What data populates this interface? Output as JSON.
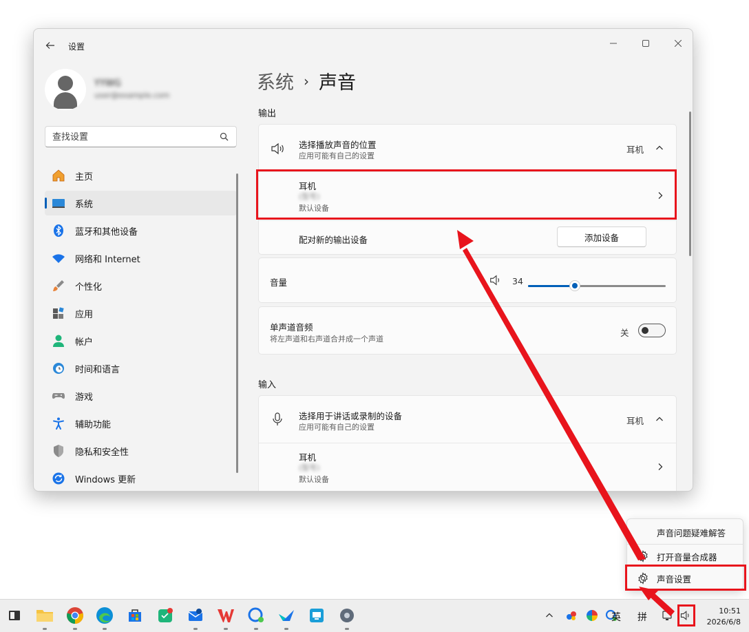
{
  "window": {
    "title": "设置",
    "back_icon": "arrow-left-icon"
  },
  "user": {
    "name": "YYWG",
    "email": "user@example.com"
  },
  "search": {
    "placeholder": "查找设置"
  },
  "sidebar": {
    "items": [
      {
        "label": "主页",
        "icon": "home-icon"
      },
      {
        "label": "系统",
        "icon": "system-icon",
        "active": true
      },
      {
        "label": "蓝牙和其他设备",
        "icon": "bluetooth-icon"
      },
      {
        "label": "网络和 Internet",
        "icon": "wifi-icon"
      },
      {
        "label": "个性化",
        "icon": "brush-icon"
      },
      {
        "label": "应用",
        "icon": "apps-icon"
      },
      {
        "label": "帐户",
        "icon": "account-icon"
      },
      {
        "label": "时间和语言",
        "icon": "clock-globe-icon"
      },
      {
        "label": "游戏",
        "icon": "gamepad-icon"
      },
      {
        "label": "辅助功能",
        "icon": "accessibility-icon"
      },
      {
        "label": "隐私和安全性",
        "icon": "shield-icon"
      },
      {
        "label": "Windows 更新",
        "icon": "update-icon"
      }
    ]
  },
  "breadcrumb": {
    "parent": "系统",
    "separator": "›",
    "current": "声音"
  },
  "output": {
    "heading": "输出",
    "choose_title": "选择播放声音的位置",
    "choose_sub": "应用可能有自己的设置",
    "choose_value": "耳机",
    "device_name": "耳机",
    "device_model": "(型号)",
    "device_sub": "默认设备",
    "pair_label": "配对新的输出设备",
    "add_button": "添加设备",
    "volume_label": "音量",
    "volume_value": "34",
    "volume_level": 0.34,
    "mono_title": "单声道音频",
    "mono_sub": "将左声道和右声道合并成一个声道",
    "mono_state": "关"
  },
  "input": {
    "heading": "输入",
    "choose_title": "选择用于讲话或录制的设备",
    "choose_sub": "应用可能有自己的设置",
    "choose_value": "耳机",
    "device_name": "耳机",
    "device_model": "(型号)",
    "device_sub": "默认设备"
  },
  "context_menu": {
    "items": [
      {
        "label": "声音问题疑难解答",
        "icon": ""
      },
      {
        "label": "打开音量合成器",
        "icon": "gear-icon"
      },
      {
        "label": "声音设置",
        "icon": "gear-icon"
      }
    ]
  },
  "taskbar": {
    "lang": "英",
    "ime": "拼",
    "time": "10:51",
    "date": "2026/6/8"
  },
  "colors": {
    "accent": "#005fb8",
    "highlight": "#e8141c"
  }
}
